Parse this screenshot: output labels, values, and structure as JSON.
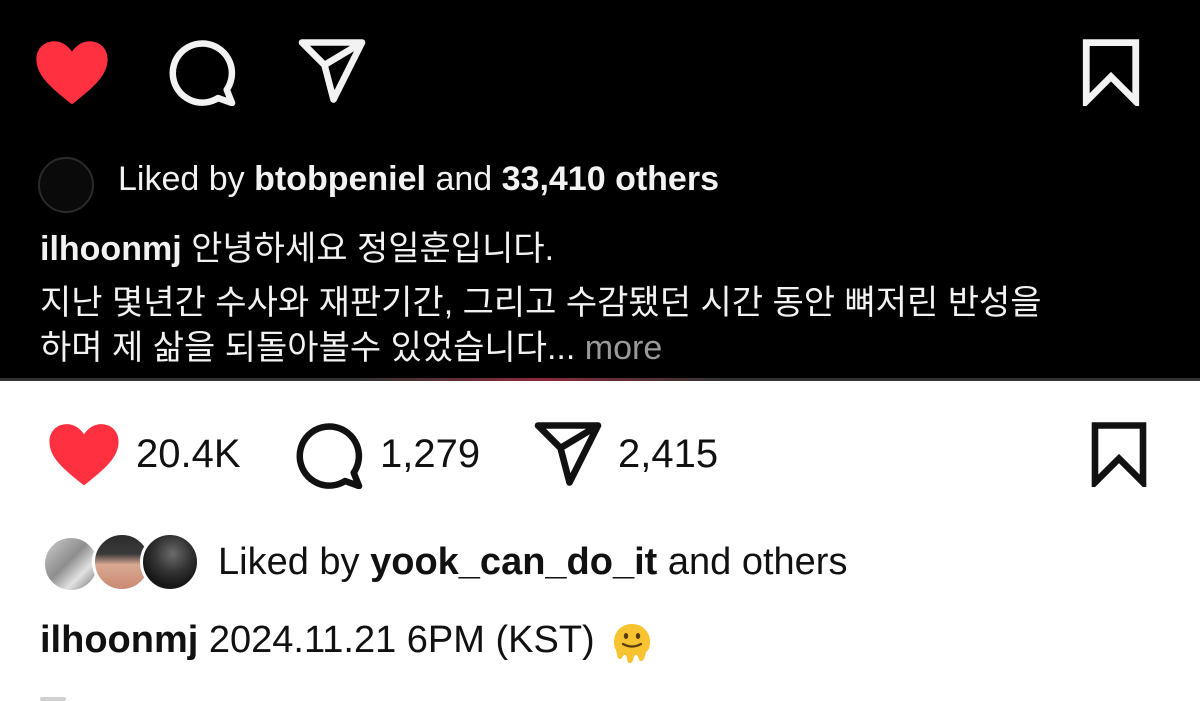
{
  "dark_post": {
    "liked_by_prefix": "Liked by",
    "liked_by_user": "btobpeniel",
    "liked_by_and": "and",
    "liked_by_count": "33,410 others",
    "caption_user": "ilhoonmj",
    "caption_line1": "안녕하세요 정일훈입니다.",
    "caption_line2": "지난 몇년간 수사와 재판기간, 그리고 수감됐던 시간 동안 뼈저린 반성을",
    "caption_line3": "하며 제 삶을 되돌아볼수 있었습니다...",
    "more_label": "more",
    "colors": {
      "background": "#000000",
      "heart": "#ff3040",
      "text": "#f2f2f2",
      "more": "#9a9a9a"
    }
  },
  "light_post": {
    "like_count": "20.4K",
    "comment_count": "1,279",
    "share_count": "2,415",
    "liked_by_prefix": "Liked by",
    "liked_by_user": "yook_can_do_it",
    "liked_by_suffix": "and others",
    "caption_user": "ilhoonmj",
    "caption_text": "2024.11.21 6PM (KST)",
    "caption_emoji": "melting-face-emoji",
    "colors": {
      "background": "#ffffff",
      "heart": "#ff3040",
      "text": "#111111"
    }
  },
  "icons": [
    "heart-icon",
    "comment-icon",
    "share-icon",
    "bookmark-icon"
  ]
}
